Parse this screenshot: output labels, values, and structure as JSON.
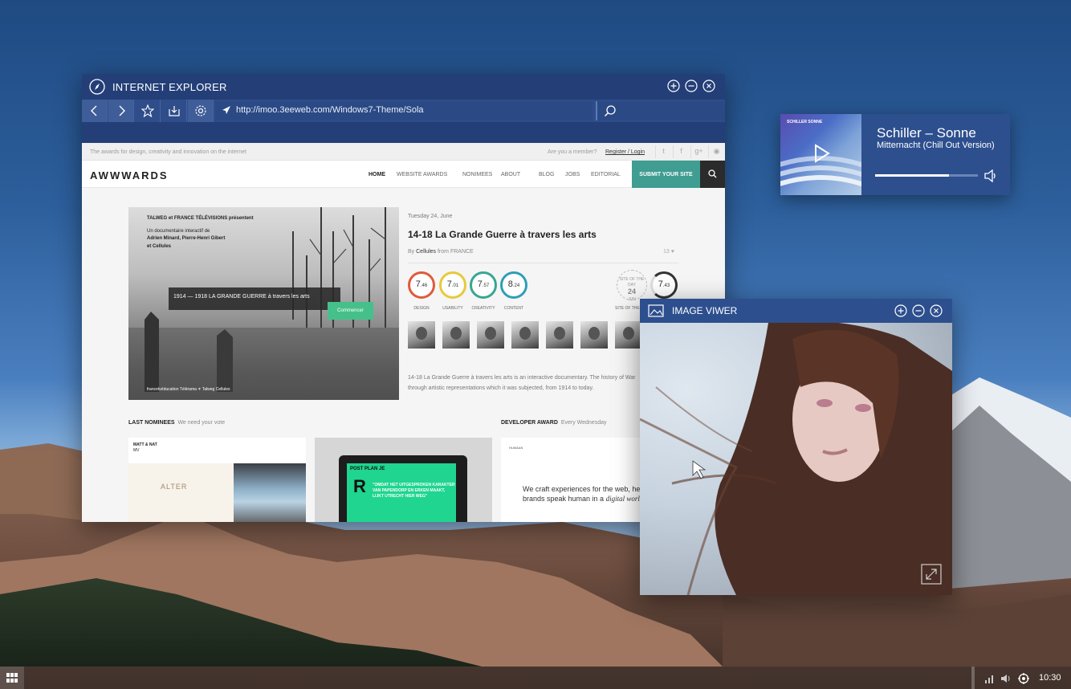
{
  "ie_window": {
    "title": "INTERNET EXPLORER",
    "url": "http://imoo.3eeweb.com/Windows7-Theme/Sola"
  },
  "site": {
    "tagline": "The awards for design, creativity and innovation on the internet",
    "member_prompt": "Are you a member?",
    "register_login": "Register / Login",
    "brand": "AWWWARDS",
    "nav": [
      "HOME",
      "WEBSITE AWARDS",
      "NONIMEES",
      "ABOUT",
      "BLOG",
      "JOBS",
      "EDITORIAL"
    ],
    "submit_label": "SUBMIT YOUR SITE",
    "hero": {
      "intro": [
        "TALWEG et FRANCE TÉLÉVISIONS présentent",
        "Un documentaire interactif de",
        "Adrien Minard, Pierre-Henri Gibert",
        "et Cellules"
      ],
      "strip": "1914 — 1918  LA GRANDE GUERRE à travers les arts",
      "cta": "Commencer",
      "logos": "francetvéducation  Télérama  ✶  Talweg  Cellules"
    },
    "date": "Tuesday 24, June",
    "title": "14-18 La Grande Guerre à travers les arts",
    "by_prefix": "By",
    "author": "Cellules",
    "from_label": "from",
    "country": "FRANCE",
    "likes": "13",
    "scores": [
      {
        "int": "7",
        "dec": ".46",
        "label": "DESIGN",
        "color": "#e05a3c"
      },
      {
        "int": "7",
        "dec": ".01",
        "label": "USABILITY",
        "color": "#e8c93a"
      },
      {
        "int": "7",
        "dec": ".57",
        "label": "CREATIVITY",
        "color": "#3aa593"
      },
      {
        "int": "8",
        "dec": ".24",
        "label": "CONTENT",
        "color": "#2e9fb6"
      }
    ],
    "sotd": {
      "top": "SITE OF THE DAY",
      "day": "24",
      "month": "JUN",
      "label": "SITE OF THE"
    },
    "final_score": {
      "int": "7",
      "dec": ".43"
    },
    "description": "14-18 La Grande Guerre à travers les arts is an interactive documentary. The history of War through artistic representations which it was subjected, from 1914 to today.",
    "last_nominees": "LAST NOMINEES",
    "last_nominees_sub": "We need your vote",
    "developer_award": "DEVELOPER AWARD",
    "developer_award_sub": "Every Wednesday",
    "card1": {
      "top": "MATT & NAT",
      "sub": "MV",
      "alter": "ALTER"
    },
    "card2": {
      "pp": "POST PLAN JE",
      "big": "R",
      "quote": "\"OMDAT HET UITGESPROKEN KARAKTER VAN PAPENDORP EN ERKEN MAAKT, LIJKT UTRECHT HIER WEG\""
    },
    "card3": {
      "nav": "HUMAAN",
      "line1": "We craft experiences for the web, hel",
      "line2_a": "brands speak human in a ",
      "line2_b": "digital world"
    }
  },
  "player": {
    "track": "Schiller – Sonne",
    "subtitle": "Mitternacht (Chill Out Version)",
    "album_label": "SCHILLER SONNE",
    "progress": 0.72
  },
  "viewer": {
    "title": "IMAGE VIWER"
  },
  "taskbar": {
    "clock": "10:30"
  },
  "colors": {
    "window": "#2d4f8e",
    "accent": "#3f9d91"
  }
}
